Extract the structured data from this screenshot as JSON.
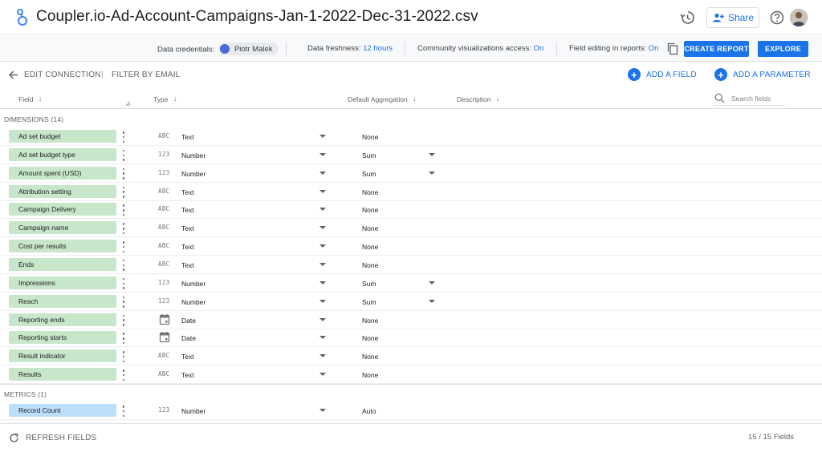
{
  "header": {
    "title": "Coupler.io-Ad-Account-Campaigns-Jan-1-2022-Dec-31-2022.csv",
    "share_label": "Share",
    "icons": [
      "logo-icon",
      "history-icon",
      "add-person-icon",
      "help-icon"
    ]
  },
  "infobar": {
    "credentials_label": "Data credentials:",
    "credentials_user": "Piotr Malek",
    "freshness_label": "Data freshness:",
    "freshness_value": "12 hours",
    "community_label": "Community visualizations access:",
    "community_value": "On",
    "field_editing_label": "Field editing in reports:",
    "field_editing_value": "On",
    "create_report_label": "CREATE REPORT",
    "explore_label": "EXPLORE"
  },
  "toolbar": {
    "edit_connection_label": "EDIT CONNECTION",
    "separator": "|",
    "filter_by_email_label": "FILTER BY EMAIL",
    "add_field_label": "ADD A FIELD",
    "add_parameter_label": "ADD A PARAMETER"
  },
  "columns": {
    "field": "Field",
    "type": "Type",
    "default_aggregation": "Default Aggregation",
    "description": "Description",
    "search_placeholder": "Search fields"
  },
  "dimensions": {
    "title": "DIMENSIONS (14)",
    "rows": [
      {
        "name": "Ad set budget",
        "type_icon": "ABC",
        "type": "Text",
        "aggregation": "None",
        "agg_dropdown": false
      },
      {
        "name": "Ad set budget type",
        "type_icon": "123",
        "type": "Number",
        "aggregation": "Sum",
        "agg_dropdown": true
      },
      {
        "name": "Amount spent (USD)",
        "type_icon": "123",
        "type": "Number",
        "aggregation": "Sum",
        "agg_dropdown": true
      },
      {
        "name": "Attribution setting",
        "type_icon": "ABC",
        "type": "Text",
        "aggregation": "None",
        "agg_dropdown": false
      },
      {
        "name": "Campaign Delivery",
        "type_icon": "ABC",
        "type": "Text",
        "aggregation": "None",
        "agg_dropdown": false
      },
      {
        "name": "Campaign name",
        "type_icon": "ABC",
        "type": "Text",
        "aggregation": "None",
        "agg_dropdown": false
      },
      {
        "name": "Cost per results",
        "type_icon": "ABC",
        "type": "Text",
        "aggregation": "None",
        "agg_dropdown": false
      },
      {
        "name": "Ends",
        "type_icon": "ABC",
        "type": "Text",
        "aggregation": "None",
        "agg_dropdown": false
      },
      {
        "name": "Impressions",
        "type_icon": "123",
        "type": "Number",
        "aggregation": "Sum",
        "agg_dropdown": true
      },
      {
        "name": "Reach",
        "type_icon": "123",
        "type": "Number",
        "aggregation": "Sum",
        "agg_dropdown": true
      },
      {
        "name": "Reporting ends",
        "type_icon": "calendar",
        "type": "Date",
        "aggregation": "None",
        "agg_dropdown": false
      },
      {
        "name": "Reporting starts",
        "type_icon": "calendar",
        "type": "Date",
        "aggregation": "None",
        "agg_dropdown": false
      },
      {
        "name": "Result indicator",
        "type_icon": "ABC",
        "type": "Text",
        "aggregation": "None",
        "agg_dropdown": false
      },
      {
        "name": "Results",
        "type_icon": "ABC",
        "type": "Text",
        "aggregation": "None",
        "agg_dropdown": false
      }
    ]
  },
  "metrics": {
    "title": "METRICS (1)",
    "rows": [
      {
        "name": "Record Count",
        "type_icon": "123",
        "type": "Number",
        "aggregation": "Auto",
        "agg_dropdown": false
      }
    ]
  },
  "footer": {
    "refresh_label": "REFRESH FIELDS",
    "field_count": "15 / 15 Fields"
  }
}
